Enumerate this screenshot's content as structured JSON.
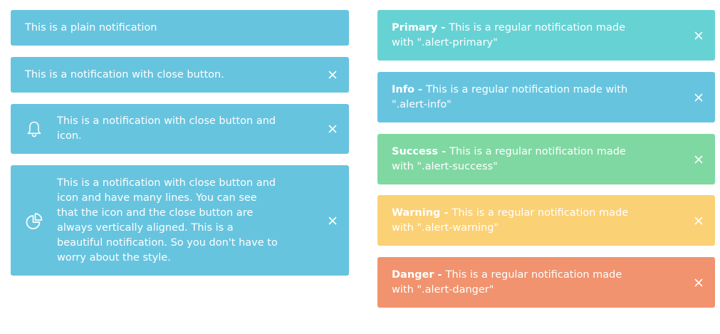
{
  "left_alerts": [
    {
      "text": "This is a plain notification"
    },
    {
      "text": "This is a notification with close button."
    },
    {
      "text": "This is a notification with close button and icon.",
      "icon": "bell-icon"
    },
    {
      "text": "This is a notification with close button and icon and have many lines. You can see that the icon and the close button are always vertically aligned. This is a beautiful notification. So you don't have to worry about the style.",
      "icon": "pie-chart-icon"
    }
  ],
  "right_alerts": [
    {
      "title": "Primary - ",
      "text": "This is a regular notification made with \".alert-primary\"",
      "color": "#66d2d4"
    },
    {
      "title": "Info - ",
      "text": "This is a regular notification made with \".alert-info\"",
      "color": "#67c4df"
    },
    {
      "title": "Success - ",
      "text": "This is a regular notification made with \".alert-success\"",
      "color": "#7fd8a2"
    },
    {
      "title": "Warning - ",
      "text": "This is a regular notification made with \".alert-warning\"",
      "color": "#fbd176"
    },
    {
      "title": "Danger - ",
      "text": "This is a regular notification made with \".alert-danger\"",
      "color": "#f0936e"
    }
  ],
  "colors": {
    "info": "#67c4df",
    "text": "#ffffff"
  }
}
